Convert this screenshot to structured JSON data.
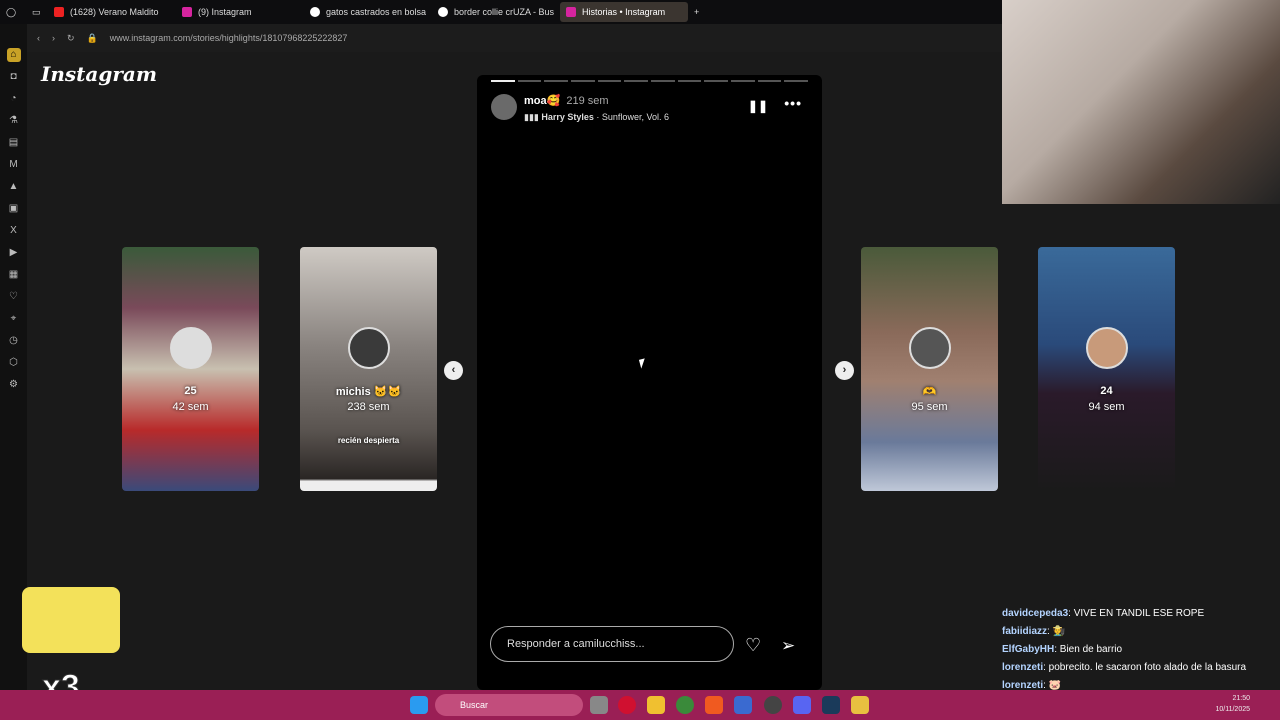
{
  "tabs": [
    {
      "label": "",
      "icon": "opera-logo"
    },
    {
      "label": "(1628) Verano Maldito",
      "icon": "youtube-icon"
    },
    {
      "label": "(9) Instagram",
      "icon": "instagram-icon"
    },
    {
      "label": "gatos castrados en bolsa",
      "icon": "google-icon"
    },
    {
      "label": "border collie crUZA - Bus",
      "icon": "google-icon"
    },
    {
      "label": "Historias • Instagram",
      "icon": "instagram-icon"
    }
  ],
  "address": {
    "url": "www.instagram.com/stories/highlights/18107968225222827"
  },
  "logo": "Instagram",
  "story": {
    "username": "moa🥰",
    "time": "219 sem",
    "artist": "Harry Styles",
    "song": "· Sunflower, Vol. 6",
    "reply_placeholder": "Responder a camilucchiss..."
  },
  "cards": [
    {
      "title": "25",
      "time": "42 sem"
    },
    {
      "title": "michis 🐱🐱",
      "time": "238 sem",
      "caption": "recién despierta"
    },
    {
      "title": "🫶",
      "time": "95 sem"
    },
    {
      "title": "24",
      "time": "94 sem"
    }
  ],
  "chat": [
    {
      "user": "davidcepeda3",
      "msg": ": VIVE EN TANDIL ESE ROPE"
    },
    {
      "user": "fabiidiazz",
      "msg": ": 🧑‍🌾"
    },
    {
      "user": "ElfGabyHH",
      "msg": ": Bien de barrio"
    },
    {
      "user": "lorenzeti",
      "msg": ": pobrecito. le sacaron foto alado de la basura"
    },
    {
      "user": "lorenzeti",
      "msg": ": 🐷"
    }
  ],
  "overlay": {
    "multiplier": "x3"
  },
  "taskbar": {
    "search": "Buscar",
    "time": "21:50",
    "date": "10/11/2025"
  },
  "colors": {
    "taskbar": "#9a1f55",
    "story_bg": "#000000"
  }
}
